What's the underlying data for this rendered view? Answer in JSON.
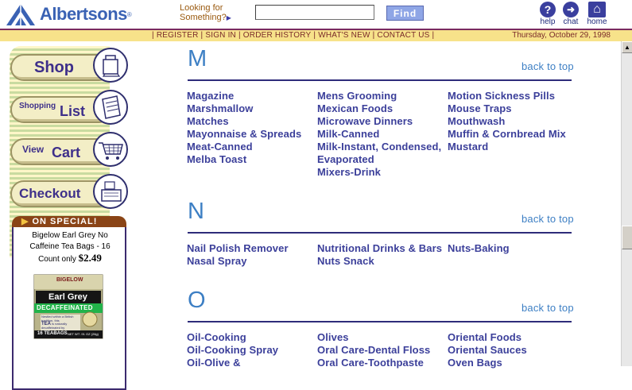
{
  "header": {
    "logo_text": "Albertsons",
    "logo_tm": "®",
    "search_prompt_line1": "Looking for",
    "search_prompt_line2": "Something?",
    "search_value": "",
    "find_label": "Find",
    "icons": [
      {
        "name": "help",
        "label": "help",
        "glyph": "?"
      },
      {
        "name": "chat",
        "label": "chat",
        "glyph": "➜"
      },
      {
        "name": "home",
        "label": "home",
        "glyph": "⌂"
      }
    ]
  },
  "navbar": {
    "links": [
      "REGISTER",
      "SIGN IN",
      "ORDER HISTORY",
      "WHAT'S NEW",
      "CONTACT US"
    ],
    "date": "Thursday, October 29, 1998"
  },
  "sidebar": {
    "buttons": [
      {
        "id": "shop",
        "label_small": "",
        "label_big": "Shop",
        "icon": "shopping-bag-icon"
      },
      {
        "id": "list",
        "label_small": "Shopping",
        "label_big": "List",
        "icon": "notepad-icon"
      },
      {
        "id": "cart",
        "label_small": "View",
        "label_big": "Cart",
        "icon": "cart-icon"
      },
      {
        "id": "checkout",
        "label_small": "",
        "label_big": "Checkout",
        "icon": "register-icon"
      }
    ],
    "special": {
      "header": "ON SPECIAL!",
      "line1": "Bigelow Earl Grey No",
      "line2": "Caffeine Tea Bags - 16",
      "line3": "Count only",
      "price": "$2.49",
      "box_brand": "BIGELOW",
      "box_name": "Earl Grey",
      "box_band": "DECAFFEINATED",
      "box_desc1": "Nestled within a British",
      "box_desc2": "tradition, this",
      "box_desc3_a": "TEA",
      "box_desc3_b": "is naturally",
      "box_desc4": "decaffeinated by",
      "box_count": "16 TEABAGS",
      "box_weight": "NET WT .91 OZ (26g)"
    }
  },
  "content": {
    "back_to_top": "back to top",
    "sections": [
      {
        "letter": "M",
        "columns": [
          [
            "Magazine",
            "Marshmallow",
            "Matches",
            "Mayonnaise & Spreads",
            "Meat-Canned",
            "Melba Toast"
          ],
          [
            "Mens Grooming",
            "Mexican Foods",
            "Microwave Dinners",
            "Milk-Canned",
            "Milk-Instant, Condensed,|Evaporated",
            "Mixers-Drink"
          ],
          [
            "Motion Sickness Pills",
            "Mouse Traps",
            "Mouthwash",
            "Muffin & Cornbread Mix",
            "Mustard"
          ]
        ]
      },
      {
        "letter": "N",
        "columns": [
          [
            "Nail Polish Remover",
            "Nasal Spray"
          ],
          [
            "Nutritional Drinks & Bars",
            "Nuts Snack"
          ],
          [
            "Nuts-Baking"
          ]
        ]
      },
      {
        "letter": "O",
        "columns": [
          [
            "Oil-Cooking",
            "Oil-Cooking Spray",
            "Oil-Olive &"
          ],
          [
            "Olives",
            "Oral Care-Dental Floss",
            "Oral Care-Toothpaste"
          ],
          [
            "Oriental Foods",
            "Oriental Sauces",
            "Oven Bags"
          ]
        ]
      }
    ]
  },
  "colors": {
    "brand_blue": "#3a62b4",
    "link": "#3b3f9a",
    "letter": "#3d7fc4",
    "nav_bg": "#f7e28a",
    "special_hdr": "#8a4416"
  }
}
